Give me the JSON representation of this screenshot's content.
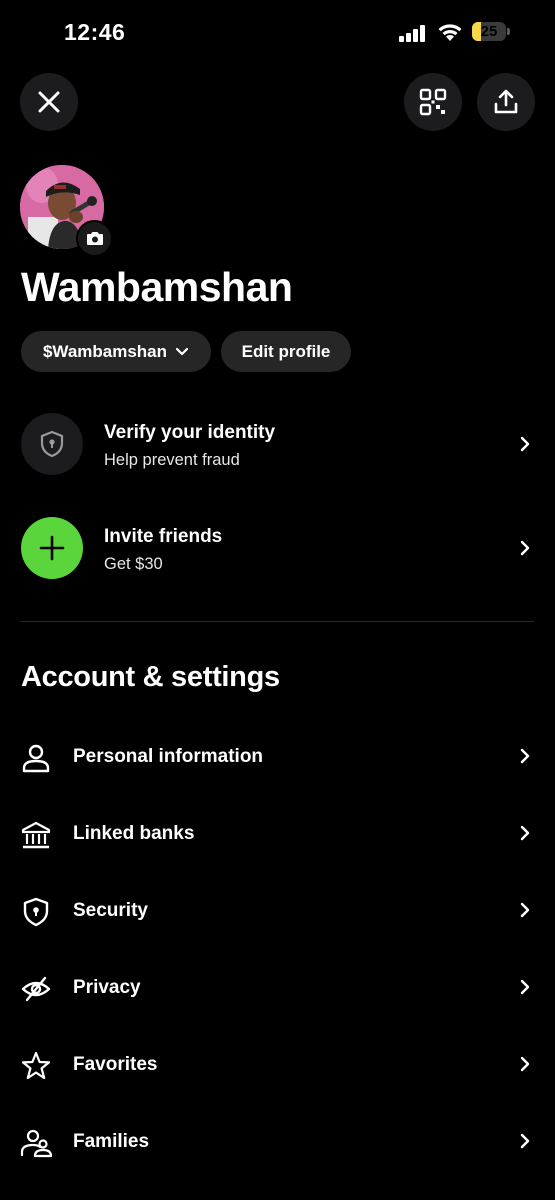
{
  "status_bar": {
    "time": "12:46",
    "battery_percent": 25,
    "battery_label": "25"
  },
  "header": {
    "close_icon": "close-icon",
    "qr_icon": "qr-code-icon",
    "share_icon": "share-icon"
  },
  "profile": {
    "name": "Wambamshan",
    "cashtag": "$Wambamshan",
    "edit_label": "Edit profile"
  },
  "promos": [
    {
      "title": "Verify your identity",
      "subtitle": "Help prevent fraud",
      "icon": "shield-icon"
    },
    {
      "title": "Invite friends",
      "subtitle": "Get $30",
      "icon": "plus-icon"
    }
  ],
  "account_settings": {
    "title": "Account & settings",
    "items": [
      {
        "label": "Personal information",
        "icon": "person-icon"
      },
      {
        "label": "Linked banks",
        "icon": "bank-icon"
      },
      {
        "label": "Security",
        "icon": "shield-lock-icon"
      },
      {
        "label": "Privacy",
        "icon": "eye-off-icon"
      },
      {
        "label": "Favorites",
        "icon": "star-icon"
      },
      {
        "label": "Families",
        "icon": "family-icon"
      }
    ]
  },
  "colors": {
    "background": "#000000",
    "surface": "#1c1c1e",
    "accent_green": "#5ad53b",
    "battery_yellow": "#f5d94a"
  }
}
